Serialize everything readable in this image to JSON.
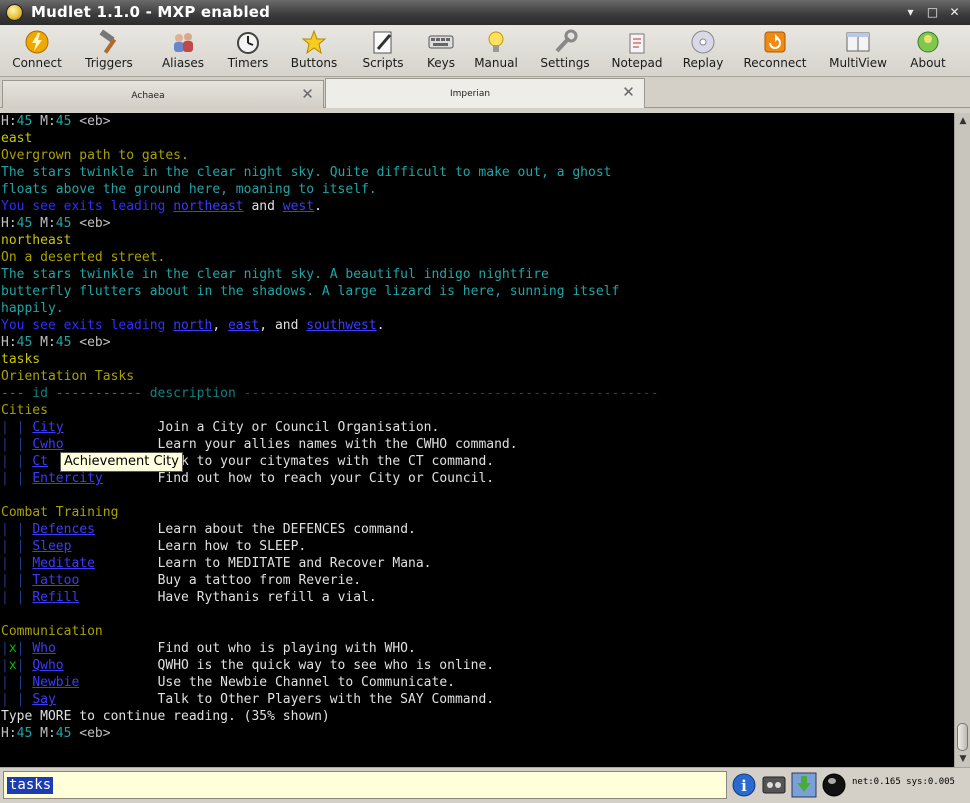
{
  "window": {
    "title": "Mudlet 1.1.0 - MXP enabled"
  },
  "toolbar": {
    "items": [
      {
        "label": "Connect",
        "icon": "lightning-icon"
      },
      {
        "label": "Triggers",
        "icon": "hammer-icon"
      },
      {
        "label": "Aliases",
        "icon": "users-icon"
      },
      {
        "label": "Timers",
        "icon": "clock-icon"
      },
      {
        "label": "Buttons",
        "icon": "star-icon"
      },
      {
        "label": "Scripts",
        "icon": "pencil-icon"
      },
      {
        "label": "Keys",
        "icon": "keyboard-icon"
      },
      {
        "label": "Manual",
        "icon": "lightbulb-icon"
      },
      {
        "label": "Settings",
        "icon": "wrench-icon"
      },
      {
        "label": "Notepad",
        "icon": "notepad-icon"
      },
      {
        "label": "Replay",
        "icon": "disc-icon"
      },
      {
        "label": "Reconnect",
        "icon": "reconnect-icon"
      },
      {
        "label": "MultiView",
        "icon": "windows-icon"
      },
      {
        "label": "About",
        "icon": "globe-icon"
      }
    ]
  },
  "tabs": [
    {
      "label": "Achaea"
    },
    {
      "label": "Imperian"
    }
  ],
  "console": {
    "prompt": {
      "h_label": "H:",
      "h_value": "45",
      "m_label": " M:",
      "m_value": "45",
      "tag": " <eb>"
    },
    "lines": {
      "l1_cmd": "east",
      "l2": "Overgrown path to gates.",
      "l3": "The stars twinkle in the clear night sky. Quite difficult to make out, a ghost",
      "l4": "floats above the ground here, moaning to itself.",
      "l5a": "You see exits leading ",
      "l5_exit1": "northeast",
      "l5b": " and ",
      "l5_exit2": "west",
      "l5c": ".",
      "l6_cmd": "northeast",
      "l7": "On a deserted street.",
      "l8": "The stars twinkle in the clear night sky. A beautiful indigo nightfire",
      "l9": "butterfly flutters about in the shadows. A large lizard is here, sunning itself",
      "l10": "happily.",
      "l11a": "You see exits leading ",
      "l11_exit1": "north",
      "l11b": ", ",
      "l11_exit2": "east",
      "l11c": ", and ",
      "l11_exit3": "southwest",
      "l11d": ".",
      "l12_cmd": "tasks",
      "l13": "Orientation Tasks",
      "l14a": "--- id ----------- description ",
      "l14b": "-----------------------------------------------------",
      "cat1": "Cities",
      "cat2": "Combat Training",
      "cat3": "Communication",
      "more": "Type MORE to continue reading. (35% shown)"
    },
    "tasks": {
      "cities": [
        {
          "mark": " ",
          "id": "City",
          "desc": "Join a City or Council Organisation."
        },
        {
          "mark": " ",
          "id": "Cwho",
          "desc": "Learn your allies names with the CWHO command."
        },
        {
          "mark": " ",
          "id": "Ct",
          "desc": "Talk to your citymates with the CT command."
        },
        {
          "mark": " ",
          "id": "Entercity",
          "desc": "Find out how to reach your City or Council."
        }
      ],
      "combat": [
        {
          "mark": " ",
          "id": "Defences",
          "desc": "Learn about the DEFENCES command."
        },
        {
          "mark": " ",
          "id": "Sleep",
          "desc": "Learn how to SLEEP."
        },
        {
          "mark": " ",
          "id": "Meditate",
          "desc": "Learn to MEDITATE and Recover Mana."
        },
        {
          "mark": " ",
          "id": "Tattoo",
          "desc": "Buy a tattoo from Reverie."
        },
        {
          "mark": " ",
          "id": "Refill",
          "desc": "Have Rythanis refill a vial."
        }
      ],
      "communication": [
        {
          "mark": "x",
          "id": "Who",
          "desc": "Find out who is playing with WHO."
        },
        {
          "mark": "x",
          "id": "Qwho",
          "desc": "QWHO is the quick way to see who is online."
        },
        {
          "mark": " ",
          "id": "Newbie",
          "desc": "Use the Newbie Channel to Communicate."
        },
        {
          "mark": " ",
          "id": "Say",
          "desc": "Talk to Other Players with the SAY Command."
        }
      ]
    },
    "tooltip": "Achievement City"
  },
  "command": {
    "value": "tasks",
    "status": "net:0.165 sys:0.005"
  },
  "colors": {
    "cyan": "#1fa5a5",
    "yellow": "#c7c700",
    "olive": "#a8a200",
    "link_blue": "#3b3bff",
    "input_bg": "#ffffd8"
  }
}
